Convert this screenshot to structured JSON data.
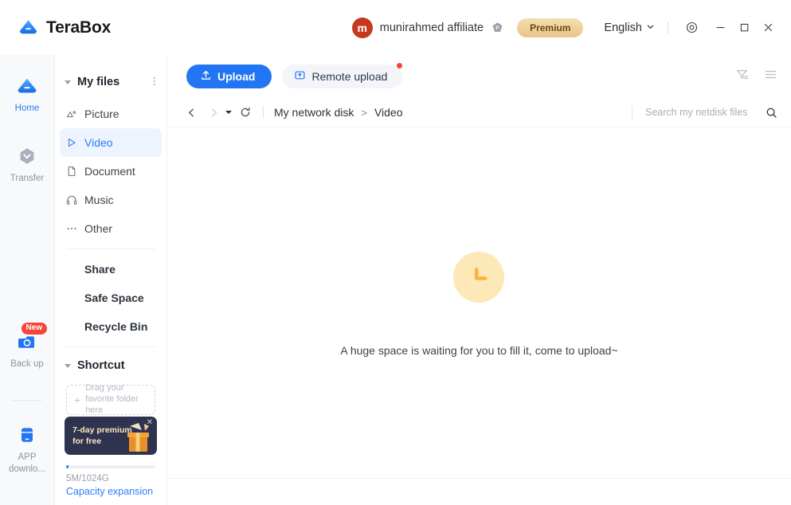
{
  "app": {
    "brand_name": "TeraBox"
  },
  "titlebar": {
    "account_name": "munirahmed affiliate",
    "avatar_initial": "m",
    "premium_label": "Premium",
    "language": "English",
    "icons": {
      "logo": "terabox-cloud-logo",
      "p_badge": "premium-p-badge",
      "lang_caret": "chevron-down-icon",
      "settings": "settings-target-icon",
      "minimize": "minimize-icon",
      "maximize": "maximize-icon",
      "close": "close-icon"
    }
  },
  "rail": {
    "items": [
      {
        "label": "Home",
        "icon": "cloud-icon",
        "active": true,
        "badge": null
      },
      {
        "label": "Transfer",
        "icon": "transfer-hexagon-icon",
        "active": false,
        "badge": null
      },
      {
        "label": "Back up",
        "icon": "backup-sync-icon",
        "active": false,
        "badge": "New"
      },
      {
        "label": "APP downlo...",
        "icon": "app-download-icon",
        "active": false,
        "badge": null
      }
    ]
  },
  "tree": {
    "header": {
      "label": "My files",
      "menu_icon": "more-vertical-icon"
    },
    "items": [
      {
        "label": "Picture",
        "icon": "picture-icon",
        "selected": false
      },
      {
        "label": "Video",
        "icon": "video-play-icon",
        "selected": true
      },
      {
        "label": "Document",
        "icon": "document-icon",
        "selected": false
      },
      {
        "label": "Music",
        "icon": "music-headphone-icon",
        "selected": false
      },
      {
        "label": "Other",
        "icon": "other-ellipsis-icon",
        "selected": false
      }
    ],
    "links": [
      {
        "label": "Share"
      },
      {
        "label": "Safe Space"
      },
      {
        "label": "Recycle Bin"
      }
    ],
    "shortcut": {
      "label": "Shortcut"
    },
    "dropzone": {
      "label": "Drag your favorite folder here",
      "plus_icon": "plus-icon"
    },
    "promo": {
      "line1": "7-day premium",
      "line2": "for free",
      "close_icon": "close-icon",
      "gift_icon": "gift-box-icon"
    },
    "storage": {
      "used_total": "5M/1024G",
      "expand_label": "Capacity expansion",
      "percent": 0.5
    }
  },
  "toolbar": {
    "upload_label": "Upload",
    "upload_icon": "upload-arrow-icon",
    "remote_label": "Remote upload",
    "remote_icon": "remote-upload-icon",
    "filter_icon": "filter-funnel-icon",
    "listview_icon": "list-view-icon"
  },
  "breadcrumb": {
    "back_icon": "chevron-left-icon",
    "forward_icon": "chevron-right-icon",
    "history_caret_icon": "caret-down-icon",
    "refresh_icon": "refresh-icon",
    "path": [
      "My network disk",
      "Video"
    ],
    "separator": ">"
  },
  "search": {
    "placeholder": "Search my netdisk files",
    "value": "",
    "icon": "search-icon"
  },
  "empty_state": {
    "message": "A huge space is waiting for you to fill it, come to upload~",
    "icon": "clock-icon",
    "circle_color": "#FDE8B8",
    "hand_color": "#F8B63F"
  },
  "colors": {
    "accent": "#2276F4",
    "brand_blue": "#2b7cf6",
    "alert_red": "#F4443B",
    "premium_gold": "#E8C489"
  }
}
